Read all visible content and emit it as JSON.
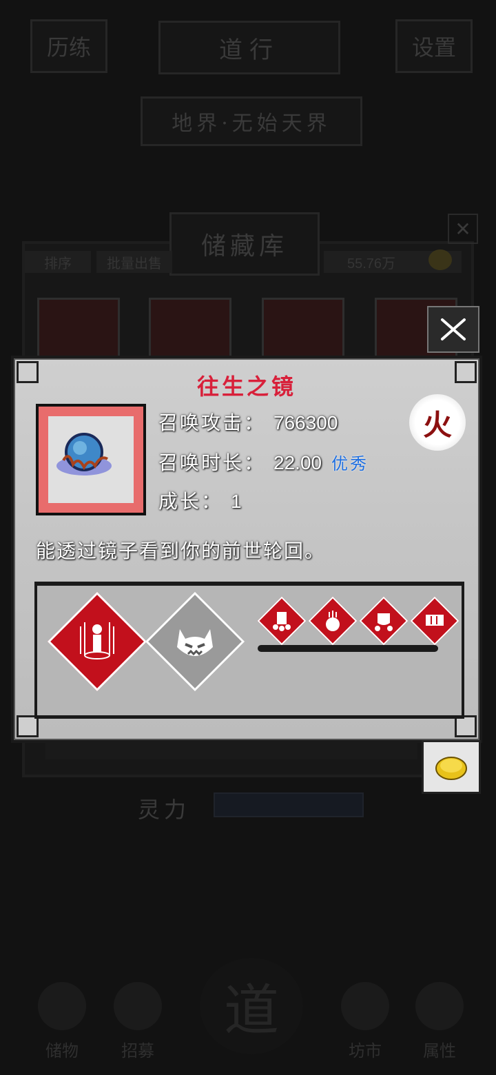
{
  "background": {
    "top_left_button": "历练",
    "top_center_banner": "道行",
    "top_right_button": "设置",
    "second_banner": "地界·无始天界",
    "storage_title": "储藏库",
    "sort_tab": "排序",
    "batch_sell_tab": "批量出售",
    "currency_amount": "55.76万",
    "bottom_stat_label": "灵力",
    "bottom_nav": [
      "储物",
      "招募",
      "道",
      "坊市",
      "属性"
    ]
  },
  "dialog": {
    "item_name": "往生之镜",
    "element": "火",
    "stats": [
      {
        "label": "召唤攻击：",
        "value": "766300"
      },
      {
        "label": "召唤时长：",
        "value": "22.00",
        "quality": "优秀"
      },
      {
        "label": "成长：",
        "value": "1"
      }
    ],
    "description": "能透过镜子看到你的前世轮回。"
  },
  "icons": {
    "close": "close-icon",
    "coin": "coin-icon",
    "summon_skill": "summon-skill-icon",
    "demon_skill": "demon-face-icon",
    "buffs": [
      "skull-buff-icon",
      "weapon-buff-icon",
      "mask-buff-icon",
      "banner-buff-icon"
    ]
  },
  "colors": {
    "item_name": "#d8203a",
    "quality": "#1f6fe0",
    "element": "#8c1010",
    "skill_red": "#c2101c"
  }
}
